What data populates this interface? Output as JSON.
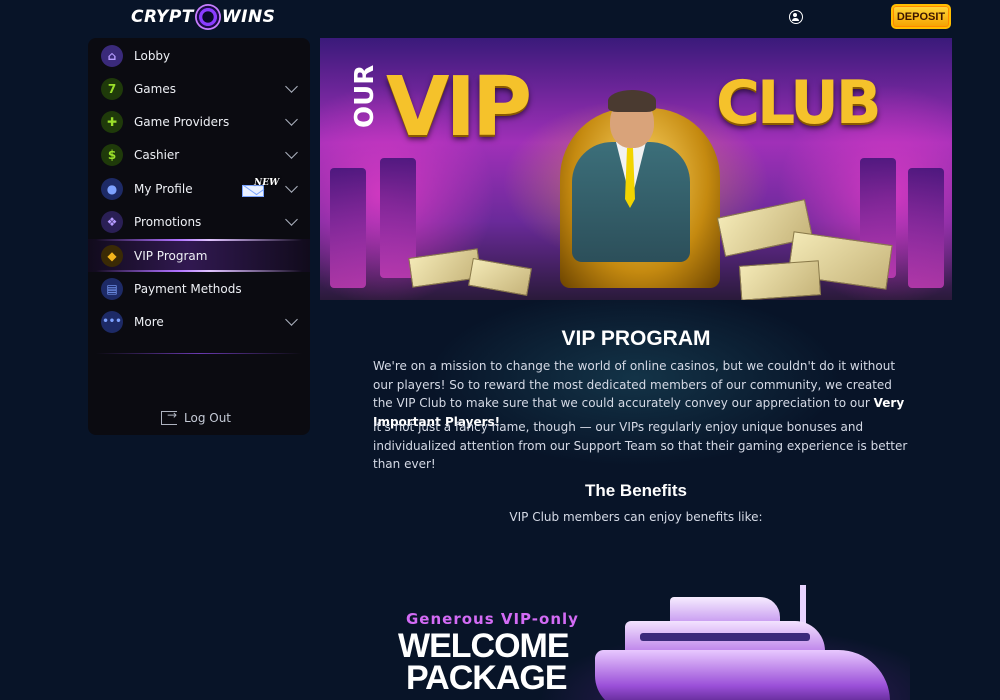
{
  "header": {
    "logo_left": "CRYPT",
    "logo_right": "WINS",
    "deposit_label": "DEPOSIT"
  },
  "sidebar": {
    "items": [
      {
        "label": "Lobby",
        "icon": "house-icon",
        "color": "#7b5cff",
        "has_chevron": false
      },
      {
        "label": "Games",
        "icon": "seven-icon",
        "color": "#7cd11e",
        "has_chevron": true
      },
      {
        "label": "Game Providers",
        "icon": "puzzle-icon",
        "color": "#7cd11e",
        "has_chevron": true
      },
      {
        "label": "Cashier",
        "icon": "dollar-icon",
        "color": "#7cd11e",
        "has_chevron": true
      },
      {
        "label": "My Profile",
        "icon": "profile-icon",
        "color": "#4a6ad6",
        "has_chevron": true,
        "badge": "NEW"
      },
      {
        "label": "Promotions",
        "icon": "gift-icon",
        "color": "#6a4ab6",
        "has_chevron": true
      },
      {
        "label": "VIP Program",
        "icon": "diamond-icon",
        "color": "#f3b51c",
        "has_chevron": false,
        "active": true
      },
      {
        "label": "Payment Methods",
        "icon": "wallet-icon",
        "color": "#4a6ad6",
        "has_chevron": false
      },
      {
        "label": "More",
        "icon": "more-icon",
        "color": "#4a6ad6",
        "has_chevron": true
      }
    ],
    "logout_label": "Log Out"
  },
  "banner": {
    "our": "OUR",
    "vip": "VIP",
    "club": "CLUB"
  },
  "content": {
    "title": "VIP PROGRAM",
    "p1_text": "We're on a mission to change the world of online casinos, but we couldn't do it without our players! So to reward the most dedicated members of our community, we created the VIP Club to make sure that we could accurately convey our appreciation to our ",
    "p1_bold": "Very Important Players!",
    "p2": "It's not just a fancy name, though — our VIPs regularly enjoy unique bonuses and individualized attention from our Support Team so that their gaming experience is better than ever!",
    "benefits_title": "The Benefits",
    "benefits_sub": "VIP Club members can enjoy benefits like:"
  },
  "promo": {
    "subtitle": "Generous VIP-only",
    "title_line1": "WELCOME",
    "title_line2": "PACKAGE"
  },
  "colors": {
    "background": "#081428",
    "deposit": "#ffc61a",
    "accent_purple": "#9b5cff"
  }
}
